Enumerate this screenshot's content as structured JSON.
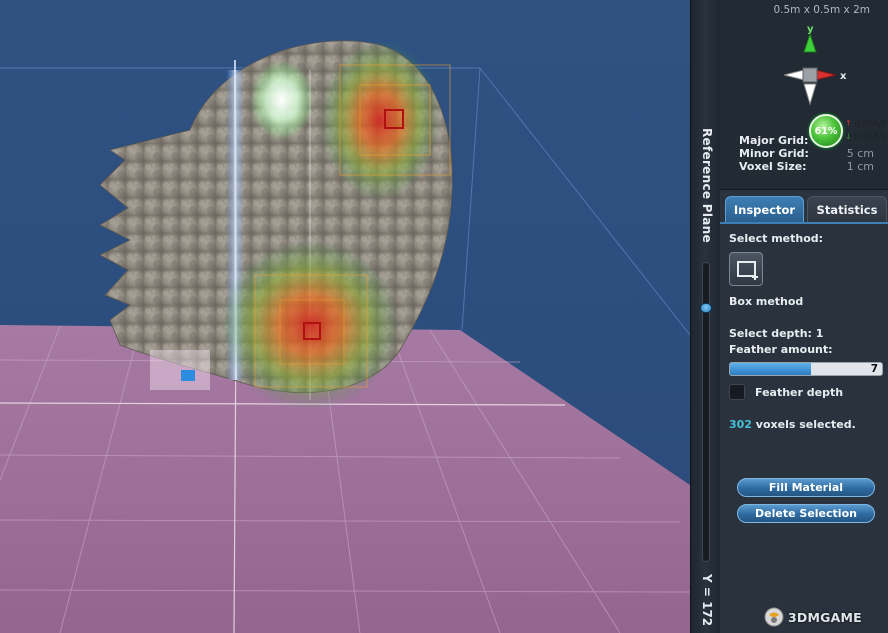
{
  "viewport": {
    "colors": {
      "background": "#2d4f80",
      "floor": "#9c6e98",
      "grid_line": "#ffffff"
    }
  },
  "reference_plane": {
    "label": "Reference Plane",
    "y_readout": "Y = 172",
    "slider_level": 0.15
  },
  "scene_info": {
    "dimensions": "0.5m x 0.5m x 2m",
    "axes": {
      "y": "y",
      "x": "x"
    },
    "rows": [
      {
        "label": "Major Grid:",
        "value": ""
      },
      {
        "label": "Minor Grid:",
        "value": "5 cm"
      },
      {
        "label": "Voxel Size:",
        "value": "1 cm"
      }
    ],
    "performance": {
      "percent": "61%",
      "upload": "0.06K/s",
      "download": "0.01K/s"
    }
  },
  "tabs": [
    {
      "label": "Inspector",
      "active": true
    },
    {
      "label": "Statistics",
      "active": false
    }
  ],
  "inspector": {
    "select_method_label": "Select method:",
    "box_method_icon": "box-select-icon",
    "box_method_label": "Box method",
    "select_depth_label": "Select depth: 1",
    "feather_amount_label": "Feather amount:",
    "feather_amount_value": "7",
    "feather_amount_fraction": 0.53,
    "feather_depth_label": "Feather depth",
    "feather_depth_checked": false,
    "selected_count": "302",
    "selected_suffix": " voxels selected.",
    "fill_material_label": "Fill Material",
    "delete_selection_label": "Delete Selection"
  },
  "watermark": {
    "text": "3DMGAME"
  }
}
